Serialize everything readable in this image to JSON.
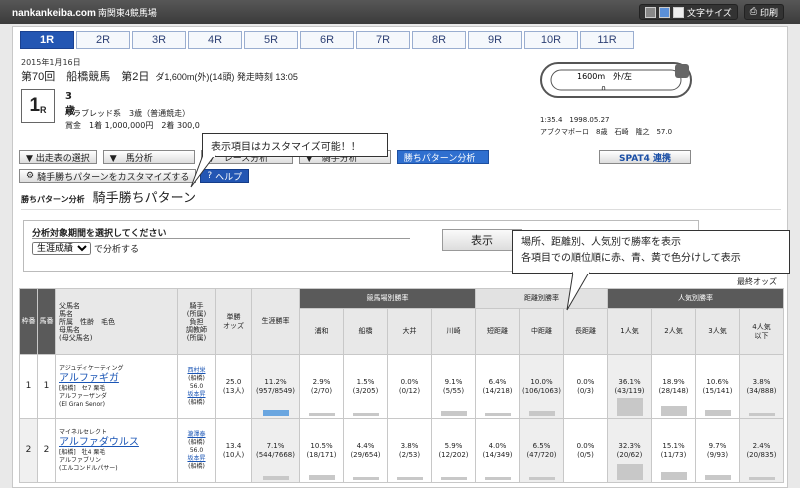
{
  "topbar": {
    "site": "nankankeiba.com",
    "site_sub": "南関東4競馬場",
    "font_size_label": "文字サイズ",
    "print_label": "印刷"
  },
  "race_tabs": [
    "1R",
    "2R",
    "3R",
    "4R",
    "5R",
    "6R",
    "7R",
    "8R",
    "9R",
    "10R",
    "11R"
  ],
  "race": {
    "date": "2015年1月16日",
    "title": "第70回　船橋競馬　第2日",
    "conditions": "ダ1,600m(外)(14頭) 発走時刻 13:05",
    "number": "1",
    "number_suffix": "R",
    "class": "3歳",
    "breed": "サラブレッド系　3歳（普通競走）",
    "prize": "賞金　1着 1,000,000円　2着 300,0"
  },
  "course": {
    "label": "1600m　外/左",
    "mark": "∩"
  },
  "record": {
    "line1": "1:35.4　1998.05.27",
    "line2": "アブクマポーロ　8歳　石崎　隆之　57.0"
  },
  "nav_buttons": [
    "▼ 出走表の選択",
    "▼　馬分析",
    "▼　レース分析",
    "▼　騎手分析",
    "勝ちパターン分析"
  ],
  "spat4": "SPAT4 連携",
  "customize_button": "騎手勝ちパターンをカスタマイズする",
  "help_button": "ヘルプ",
  "heading": {
    "small": "勝ちパターン分析",
    "big": "騎手勝ちパターン"
  },
  "period": {
    "label": "分析対象期間を選択してください",
    "selected": "生涯成績",
    "suffix": "で分析する",
    "show_button": "表示"
  },
  "odds_note": "最終オッズ",
  "callouts": {
    "c1": "表示項目はカスタマイズ可能！！",
    "c2_line1": "場所、距離別、人気別で勝率を表示",
    "c2_line2": "各項目での順位順に赤、青、黄で色分けして表示"
  },
  "table": {
    "h_waku": "枠番",
    "h_uma": "馬番",
    "h_horse_l1": "父馬名",
    "h_horse_l2": "馬名",
    "h_horse_l3": "所属　性齢　毛色",
    "h_horse_l4": "母馬名",
    "h_horse_l5": "(母父馬名)",
    "h_jockey_l1": "騎手",
    "h_jockey_l2": "(所属)",
    "h_jockey_l3": "負担",
    "h_jockey_l4": "調教師",
    "h_jockey_l5": "(所属)",
    "h_odds_l1": "単勝",
    "h_odds_l2": "オッズ",
    "h_win": "生涯勝率",
    "g_track": "競馬場別勝率",
    "g_dist": "距離別勝率",
    "g_pop": "人気別勝率",
    "tracks": [
      "浦和",
      "船橋",
      "大井",
      "川崎"
    ],
    "dists": [
      "短距離",
      "中距離",
      "長距離"
    ],
    "pops": [
      "1人気",
      "2人気",
      "3人気",
      "4人気\n以下"
    ],
    "rows": [
      {
        "waku": "1",
        "uma": "1",
        "sire": "アジュディケーティング",
        "name": "アルファギガ",
        "info": "[船橋]　セ7 栗毛",
        "dam": "アルファーザンダ",
        "damsire": "(El Gran Senor)",
        "jockey": "西村栄",
        "j_aff": "(船橋)",
        "weight": "56.0",
        "trainer": "坂本昇",
        "t_aff": "(船橋)",
        "odds": "25.0",
        "pop": "(13人)",
        "cells": [
          [
            "11.2%",
            "(957/8549)"
          ],
          [
            "2.9%",
            "(2/70)"
          ],
          [
            "1.5%",
            "(3/205)"
          ],
          [
            "0.0%",
            "(0/12)"
          ],
          [
            "9.1%",
            "(5/55)"
          ],
          [
            "6.4%",
            "(14/218)"
          ],
          [
            "10.0%",
            "(106/1063)"
          ],
          [
            "0.0%",
            "(0/3)"
          ],
          [
            "36.1%",
            "(43/119)"
          ],
          [
            "18.9%",
            "(28/148)"
          ],
          [
            "10.6%",
            "(15/141)"
          ],
          [
            "3.8%",
            "(34/888)"
          ]
        ],
        "levels": [
          0.11,
          0.03,
          0.02,
          0,
          0.09,
          0.06,
          0.1,
          0,
          0.36,
          0.19,
          0.11,
          0.04
        ]
      },
      {
        "waku": "2",
        "uma": "2",
        "sire": "マイネルセレクト",
        "name": "アルファダウルス",
        "info": "[船橋]　牡4 栗毛",
        "dam": "アルファブリン",
        "damsire": "(エルコンドルパサー)",
        "jockey": "瀧澤泰",
        "j_aff": "(船橋)",
        "weight": "56.0",
        "trainer": "坂本昇",
        "t_aff": "(船橋)",
        "odds": "13.4",
        "pop": "(10人)",
        "cells": [
          [
            "7.1%",
            "(544/7668)"
          ],
          [
            "10.5%",
            "(18/171)"
          ],
          [
            "4.4%",
            "(29/654)"
          ],
          [
            "3.8%",
            "(2/53)"
          ],
          [
            "5.9%",
            "(12/202)"
          ],
          [
            "4.0%",
            "(14/349)"
          ],
          [
            "6.5%",
            "(47/720)"
          ],
          [
            "0.0%",
            "(0/5)"
          ],
          [
            "32.3%",
            "(20/62)"
          ],
          [
            "15.1%",
            "(11/73)"
          ],
          [
            "9.7%",
            "(9/93)"
          ],
          [
            "2.4%",
            "(20/835)"
          ]
        ],
        "levels": [
          0.07,
          0.1,
          0.04,
          0.04,
          0.06,
          0.04,
          0.06,
          0,
          0.32,
          0.15,
          0.1,
          0.02
        ]
      }
    ]
  }
}
